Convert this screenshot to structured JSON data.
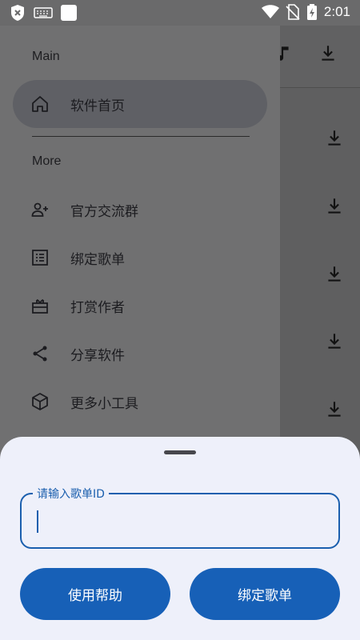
{
  "status_bar": {
    "time": "2:01",
    "icons": [
      "shield-x-icon",
      "keyboard-icon",
      "app-square-icon",
      "wifi-icon",
      "no-sim-icon",
      "battery-charging-icon"
    ]
  },
  "drawer": {
    "section_main": "Main",
    "section_more": "More",
    "items": [
      {
        "label": "软件首页",
        "icon": "home-icon"
      },
      {
        "label": "官方交流群",
        "icon": "add-person-icon"
      },
      {
        "label": "绑定歌单",
        "icon": "list-icon"
      },
      {
        "label": "打赏作者",
        "icon": "gift-icon"
      },
      {
        "label": "分享软件",
        "icon": "share-icon"
      },
      {
        "label": "更多小工具",
        "icon": "cube-icon"
      }
    ]
  },
  "sheet": {
    "field_label": "请输入歌单ID",
    "field_value": "",
    "help_button": "使用帮助",
    "bind_button": "绑定歌单"
  },
  "colors": {
    "accent": "#1760b7",
    "sheet_bg": "#eef0fa",
    "scrim": "#6f6f6f"
  }
}
